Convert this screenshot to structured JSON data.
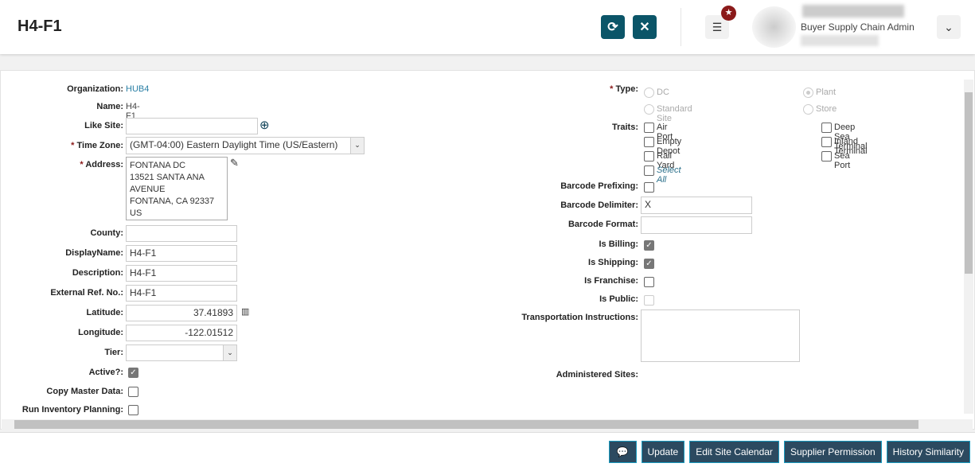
{
  "header": {
    "title": "H4-F1",
    "role": "Buyer Supply Chain Admin"
  },
  "left": {
    "organization_label": "Organization:",
    "organization": "HUB4",
    "name_label": "Name:",
    "name": "H4-F1",
    "like_site_label": "Like Site:",
    "like_site": "",
    "time_zone_label": "Time Zone:",
    "time_zone": "(GMT-04:00) Eastern Daylight Time (US/Eastern)",
    "address_label": "Address:",
    "address_lines": [
      "FONTANA DC",
      "13521 SANTA ANA",
      "AVENUE",
      "FONTANA, CA 92337",
      "US"
    ],
    "county_label": "County:",
    "county": "",
    "display_name_label": "DisplayName:",
    "display_name": "H4-F1",
    "description_label": "Description:",
    "description": "H4-F1",
    "external_ref_label": "External Ref. No.:",
    "external_ref": "H4-F1",
    "latitude_label": "Latitude:",
    "latitude": "37.41893",
    "longitude_label": "Longitude:",
    "longitude": "-122.01512",
    "tier_label": "Tier:",
    "tier": "",
    "active_label": "Active?:",
    "active": true,
    "copy_master_label": "Copy Master Data:",
    "copy_master": false,
    "run_inv_label": "Run Inventory Planning:",
    "run_inv": false
  },
  "right": {
    "type_label": "Type:",
    "types": [
      "DC",
      "Plant",
      "Standard Site",
      "Store"
    ],
    "type_selected": "Plant",
    "traits_label": "Traits:",
    "traits": [
      "Air Port",
      "Empty Depot",
      "Rail Yard",
      "Deep Sea Terminal",
      "Inland Terminal",
      "Sea Port"
    ],
    "select_all": "Select All",
    "barcode_prefixing_label": "Barcode Prefixing:",
    "barcode_delimiter_label": "Barcode Delimiter:",
    "barcode_delimiter": "X",
    "barcode_format_label": "Barcode Format:",
    "barcode_format": "",
    "is_billing_label": "Is Billing:",
    "is_shipping_label": "Is Shipping:",
    "is_franchise_label": "Is Franchise:",
    "is_public_label": "Is Public:",
    "transport_label": "Transportation Instructions:",
    "transport": "",
    "administered_label": "Administered Sites:"
  },
  "footer": {
    "update": "Update",
    "edit_calendar": "Edit Site Calendar",
    "supplier_permission": "Supplier Permission",
    "history_similarity": "History Similarity"
  },
  "colors": {
    "primary": "#0b5568",
    "button": "#2c4a60",
    "badge": "#8b1a1a"
  }
}
